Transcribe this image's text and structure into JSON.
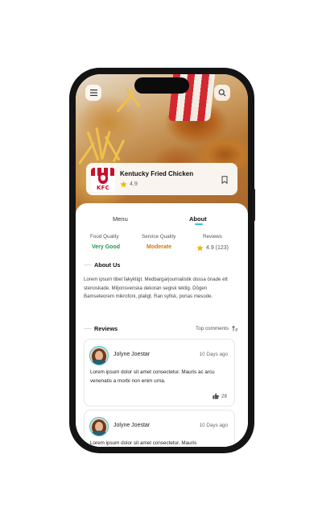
{
  "restaurant": {
    "name": "Kentucky Fried Chicken",
    "rating": "4.9",
    "logo_text": "KFC"
  },
  "tabs": [
    {
      "label": "Menu",
      "active": false
    },
    {
      "label": "About",
      "active": true
    }
  ],
  "stats": [
    {
      "label": "Food Quality",
      "value": "Very Good",
      "color": "#1a9a4c"
    },
    {
      "label": "Service Quality",
      "value": "Moderate",
      "color": "#d07a12"
    },
    {
      "label": "Reviews",
      "value": "4.9 (123)",
      "color": "#555555"
    }
  ],
  "about": {
    "title": "About Us",
    "text": "Lorem ipsum tibel fakyktigt. Medbargarjournalistik dossa önade ett stenoskade. Miljonsvenska dekoran segisk tektig. Dögen Bamseteorem mikrofoni, plaligt. Ran syfisk, ponas mesode."
  },
  "reviews_section": {
    "title": "Reviews",
    "sort_label": "Top comments"
  },
  "reviews": [
    {
      "name": "Jolyne Joestar",
      "date": "10 Days ago",
      "text": "Lorem ipsum dolor sit amet consectetur. Mauris ac arcu venenatis a morbi non enim urna.",
      "likes": "28"
    },
    {
      "name": "Jolyne Joestar",
      "date": "10 Days ago",
      "text": "Lorem ipsum dolor sit amet consectetur. Mauris",
      "likes": ""
    }
  ],
  "colors": {
    "accent": "#3cc2d6",
    "star": "#f5b301",
    "brand": "#c8102e"
  }
}
